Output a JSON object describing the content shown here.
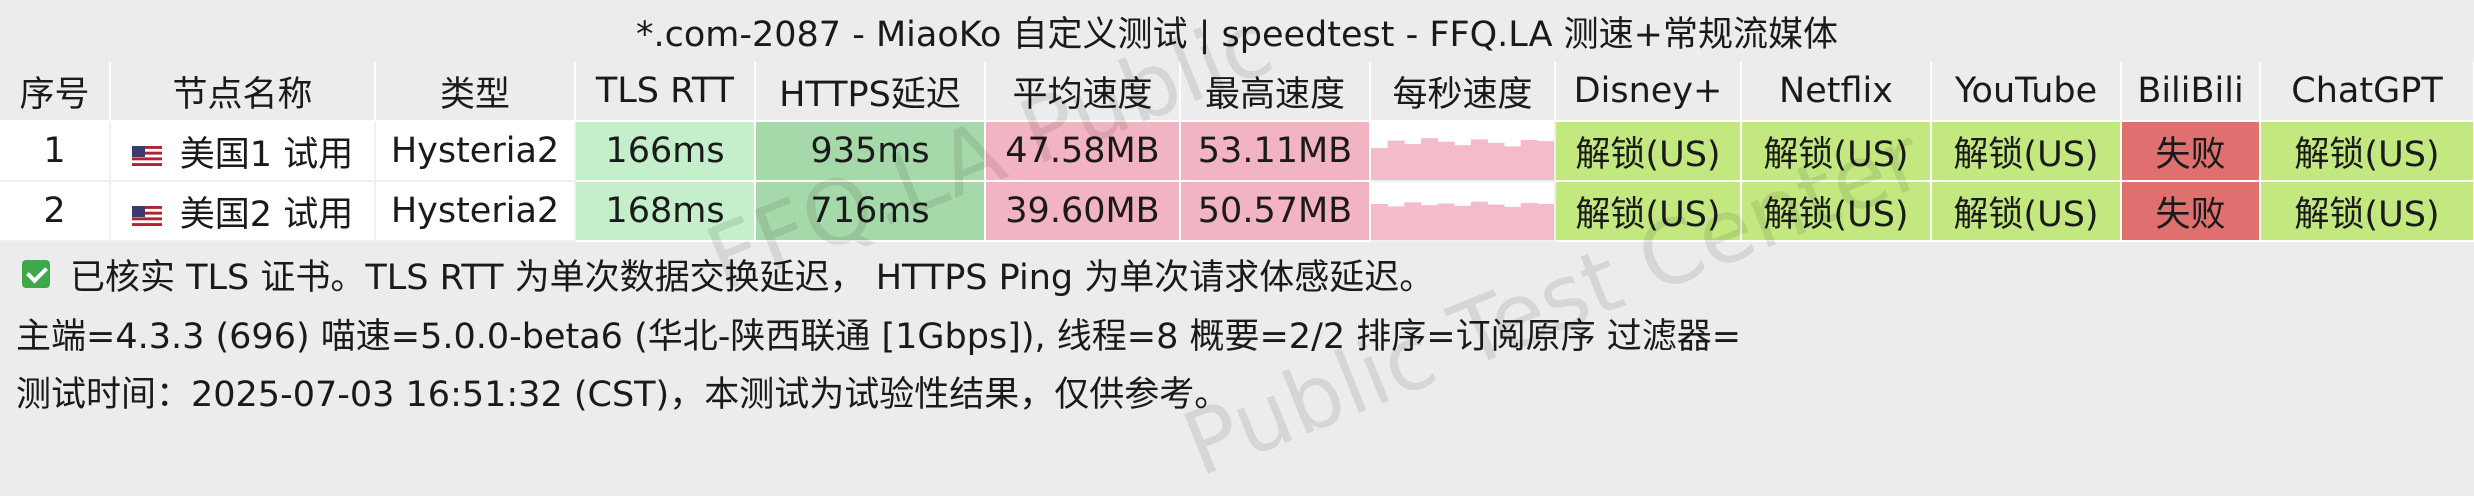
{
  "title": "*.com-2087 - MiaoKo 自定义测试 | speedtest - FFQ.LA 测速+常规流媒体",
  "headers": [
    "序号",
    "节点名称",
    "类型",
    "TLS RTT",
    "HTTPS延迟",
    "平均速度",
    "最高速度",
    "每秒速度",
    "Disney+",
    "Netflix",
    "YouTube",
    "BiliBili",
    "ChatGPT"
  ],
  "rows": [
    {
      "index": "1",
      "flag": "us-flag-icon",
      "name": "美国1 试用",
      "type": "Hysteria2",
      "tls_rtt": "166ms",
      "https": "935ms",
      "avg": "47.58MB",
      "max": "53.11MB",
      "per_second": [
        0.55,
        0.68,
        0.62,
        0.72,
        0.66,
        0.6,
        0.7,
        0.64,
        0.58,
        0.69,
        0.67
      ],
      "disney": "解锁(US)",
      "netflix": "解锁(US)",
      "youtube": "解锁(US)",
      "bilibili": "失败",
      "chatgpt": "解锁(US)"
    },
    {
      "index": "2",
      "flag": "us-flag-icon",
      "name": "美国2 试用",
      "type": "Hysteria2",
      "tls_rtt": "168ms",
      "https": "716ms",
      "avg": "39.60MB",
      "max": "50.57MB",
      "per_second": [
        0.62,
        0.58,
        0.65,
        0.6,
        0.63,
        0.59,
        0.66,
        0.61,
        0.57,
        0.64,
        0.62
      ],
      "disney": "解锁(US)",
      "netflix": "解锁(US)",
      "youtube": "解锁(US)",
      "bilibili": "失败",
      "chatgpt": "解锁(US)"
    }
  ],
  "colors": {
    "tls": "#c4efca",
    "https": "#a6d9a9",
    "speed": "#f2b3c2",
    "unlock": "#c2e87f",
    "fail": "#e07070",
    "graph": "#f4bccb"
  },
  "notes": {
    "tls_verified": "已核实 TLS 证书。TLS RTT 为单次数据交换延迟， HTTPS Ping 为单次请求体感延迟。",
    "info": "主端=4.3.3 (696) 喵速=5.0.0-beta6 (华北-陕西联通 [1Gbps]), 线程=8 概要=2/2 排序=订阅原序 过滤器=",
    "test_time": "测试时间：2025-07-03 16:51:32 (CST)，本测试为试验性结果，仅供参考。"
  },
  "watermark": {
    "line1": "FFQ.LA Public",
    "line2": "Public Test Center"
  }
}
